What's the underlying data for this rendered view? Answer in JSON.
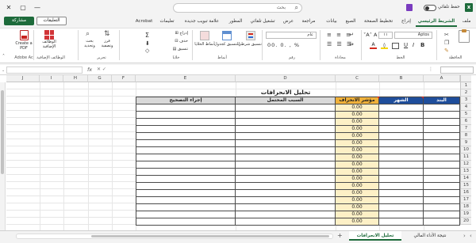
{
  "title_bar": {
    "autosave_label": "حفظ تلقائي",
    "search_placeholder": "بحث",
    "minimize": "—",
    "maximize": "▢",
    "close": "✕"
  },
  "ribbon_tabs": [
    "ملف",
    "الشريط الرئيسي",
    "إدراج",
    "تخطيط الصفحة",
    "الصيغ",
    "بيانات",
    "مراجعة",
    "عرض",
    "تشغيل تلقائي",
    "المطور",
    "علامة تبويب جديدة",
    "تعليمات",
    "Acrobat"
  ],
  "ribbon_buttons": {
    "comments": "التعليقات",
    "share": "مشاركة"
  },
  "ribbon": {
    "clipboard_label": "الحافظة",
    "font_name": "Aptos",
    "font_size": "١١",
    "font_label": "الخط",
    "alignment_label": "محاذاة",
    "number_format": "عام",
    "number_label": "رقم",
    "conditional_formatting": "تنسيق شرطي",
    "format_as_table": "التنسيق كجدول",
    "cell_styles": "أنماط الخلايا",
    "styles_label": "أنماط",
    "insert": "إدراج",
    "delete": "حذف",
    "format": "تنسيق",
    "cells_label": "خلايا",
    "sort_filter": "فرز وتصفية",
    "find_select": "بحث وتحديد",
    "editing_label": "تحرير",
    "addins": "الوظائف الإضافية",
    "addins_label": "الوظائف الإضافية",
    "create_pdf": "Create a PDF",
    "adobe_label": "Adobe Ac"
  },
  "formula_bar": {
    "fx": "fx",
    "value": ""
  },
  "columns": [
    "A",
    "B",
    "C",
    "D",
    "E",
    "F",
    "G",
    "H",
    "I",
    "J"
  ],
  "rows": [
    "1",
    "2",
    "3",
    "4",
    "5",
    "6",
    "7",
    "8",
    "9",
    "10",
    "11",
    "12",
    "13",
    "14",
    "15",
    "16",
    "17",
    "18",
    "19",
    "20",
    "21"
  ],
  "sheet": {
    "title": "تحليل الانحرافات",
    "headers": {
      "item": "البند",
      "month": "الشهر",
      "deviation_index": "مؤشر الانحراف",
      "possible_cause": "السبب المحتمل",
      "corrective_action": "إجراء التصحيح"
    },
    "values": [
      "0.00",
      "0.00",
      "0.00",
      "0.00",
      "0.00",
      "0.00",
      "0.00",
      "0.00",
      "0.00",
      "0.00",
      "0.00",
      "0.00",
      "0.00",
      "0.00",
      "0.00",
      "0.00",
      "0.00",
      "0.00",
      "0.00"
    ]
  },
  "sheet_tabs": [
    "نتيجة الأداء المالي",
    "تحليل الانحرافات"
  ],
  "colors": {
    "accent": "#1d6b3b",
    "header_blue": "#1f4e9b",
    "header_orange": "#f0b13a",
    "value_fill": "#fdf0c6"
  }
}
